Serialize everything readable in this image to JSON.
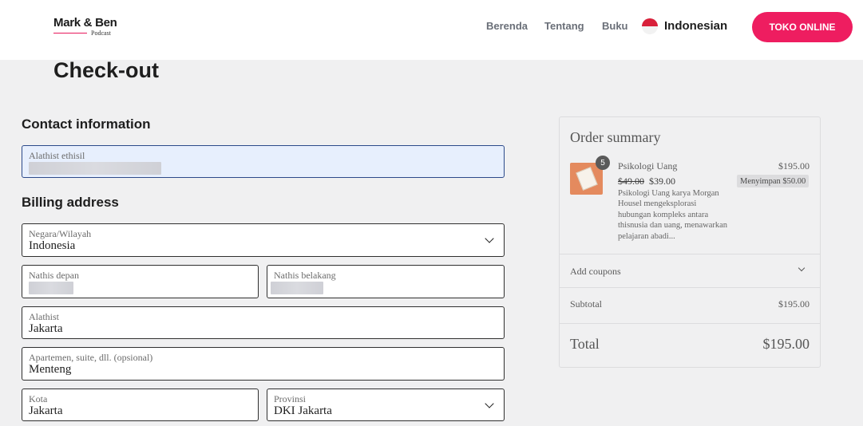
{
  "header": {
    "logo_main": "Mark & Ben",
    "logo_sub": "Podcast",
    "nav": [
      "Berenda",
      "Tentang",
      "Buku"
    ],
    "language": "Indonesian",
    "cta_label": "TOKO ONLINE",
    "brand_color": "#ee1d60"
  },
  "page": {
    "title": "Check-out"
  },
  "contact": {
    "section_title": "Contact information",
    "email_label": "Alathist ethisil"
  },
  "billing": {
    "section_title": "Billing address",
    "country_label": "Negara/Wilayah",
    "country_value": "Indonesia",
    "first_name_label": "Nathis depan",
    "last_name_label": "Nathis belakang",
    "address_label": "Alathist",
    "address_value": "Jakarta",
    "apartment_label": "Apartemen, suite, dll. (opsional)",
    "apartment_value": "Menteng",
    "city_label": "Kota",
    "city_value": "Jakarta",
    "province_label": "Provinsi",
    "province_value": "DKI Jakarta"
  },
  "summary": {
    "title": "Order summary",
    "item": {
      "quantity": "5",
      "name": "Psikologi Uang",
      "line_total": "$195.00",
      "old_price": "$49.00",
      "price": "$39.00",
      "savings": "Menyimpan $50.00",
      "description": "Psikologi Uang karya Morgan Housel mengeksplorasi hubungan kompleks antara thisnusia dan uang, menawarkan pelajaran abadi..."
    },
    "coupons_label": "Add coupons",
    "subtotal_label": "Subtotal",
    "subtotal_value": "$195.00",
    "total_label": "Total",
    "total_value": "$195.00"
  }
}
